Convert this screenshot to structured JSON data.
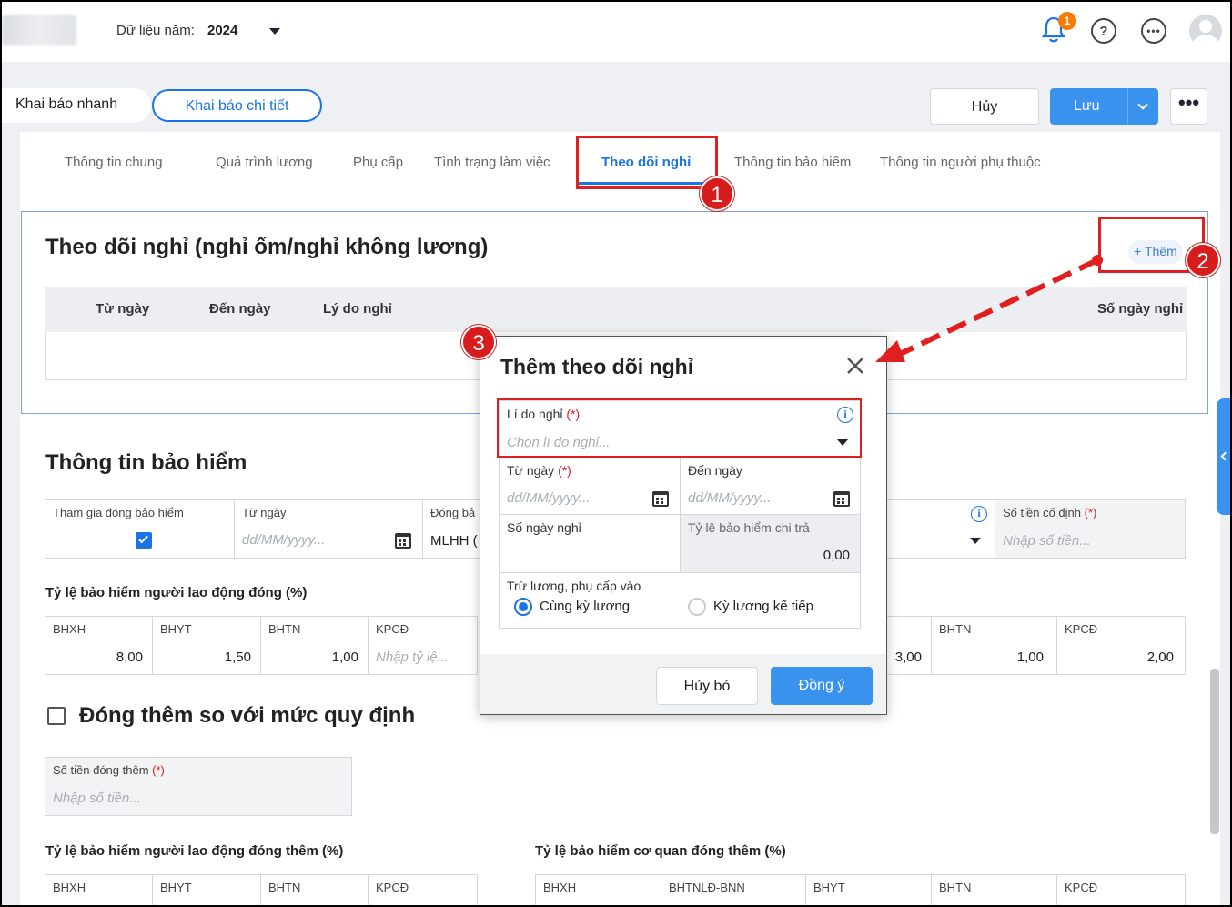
{
  "header": {
    "year_label": "Dữ liệu năm:",
    "year_value": "2024",
    "notification_count": "1"
  },
  "modes": {
    "quick": "Khai báo nhanh",
    "detail": "Khai báo chi tiết"
  },
  "actions": {
    "cancel": "Hủy",
    "save": "Lưu"
  },
  "tabs": [
    {
      "label": "Thông tin chung"
    },
    {
      "label": "Quá trình lương"
    },
    {
      "label": "Phụ cấp"
    },
    {
      "label": "Tình trạng làm việc"
    },
    {
      "label": "Theo dõi nghỉ"
    },
    {
      "label": "Thông tin bảo hiểm"
    },
    {
      "label": "Thông tin người phụ thuộc"
    }
  ],
  "leave_section": {
    "title": "Theo dõi nghỉ (nghỉ ốm/nghỉ không lương)",
    "add_label": "+ Thêm",
    "columns": [
      "Từ ngày",
      "Đến ngày",
      "Lý do nghỉ",
      "Số ngày nghỉ"
    ]
  },
  "insurance": {
    "title": "Thông tin bảo hiểm",
    "participate_label": "Tham gia đóng bảo hiểm",
    "from_label": "Từ ngày",
    "from_placeholder": "dd/MM/yyyy...",
    "pay_label": "Đóng bả",
    "pay_value": "MLHH (",
    "fixed_label": "Số tiền cố định",
    "fixed_placeholder": "Nhập số tiền...",
    "req_mark": "(*)",
    "employee_rate_title": "Tỷ lệ bảo hiểm người lao động đóng (%)",
    "employee_rates": [
      {
        "label": "BHXH",
        "value": "8,00"
      },
      {
        "label": "BHYT",
        "value": "1,50"
      },
      {
        "label": "BHTN",
        "value": "1,00"
      },
      {
        "label": "KPCĐ",
        "placeholder": "Nhập tỷ lệ..."
      }
    ],
    "company_rates_visible": [
      {
        "value": "3,00"
      },
      {
        "label": "BHTN",
        "value": "1,00"
      },
      {
        "label": "KPCĐ",
        "value": "2,00"
      }
    ],
    "extra_title": "Đóng thêm so với mức quy định",
    "extra_amount_label": "Số tiền đóng thêm",
    "extra_amount_placeholder": "Nhập số tiền...",
    "extra_employee_title": "Tỷ lệ bảo hiểm người lao động đóng thêm (%)",
    "extra_employee_cols": [
      "BHXH",
      "BHYT",
      "BHTN",
      "KPCĐ"
    ],
    "extra_company_title": "Tỷ lệ bảo hiểm cơ quan đóng thêm (%)",
    "extra_company_cols": [
      "BHXH",
      "BHTNLĐ-BNN",
      "BHYT",
      "BHTN",
      "KPCĐ"
    ]
  },
  "modal": {
    "title": "Thêm theo dõi nghỉ",
    "reason_label": "Lí do nghỉ",
    "reason_placeholder": "Chọn lí do nghỉ...",
    "from_label": "Từ ngày",
    "to_label": "Đến ngày",
    "date_placeholder": "dd/MM/yyyy...",
    "days_label": "Số ngày nghỉ",
    "rate_label": "Tỷ lệ bảo hiểm chi trả",
    "rate_value": "0,00",
    "deduct_label": "Trừ lương, phụ cấp vào",
    "option_same": "Cùng kỳ lương",
    "option_next": "Kỳ lương kế tiếp",
    "cancel": "Hủy bỏ",
    "ok": "Đồng ý",
    "req_mark": "(*)"
  },
  "callouts": [
    "1",
    "2",
    "3"
  ],
  "colors": {
    "primary": "#1a73e8",
    "annotation": "#e02020",
    "save_button": "#3a92ef"
  }
}
